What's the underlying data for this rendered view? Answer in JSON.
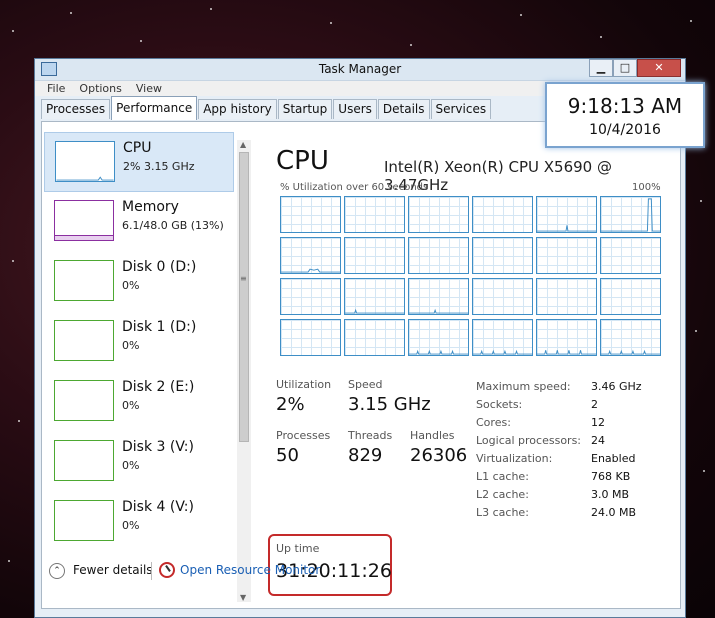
{
  "window": {
    "title": "Task Manager",
    "minimize": "▁",
    "maximize": "□",
    "close": "✕"
  },
  "menu": [
    "File",
    "Options",
    "View"
  ],
  "tabs": [
    "Processes",
    "Performance",
    "App history",
    "Startup",
    "Users",
    "Details",
    "Services"
  ],
  "active_tab": "Performance",
  "sidebar": [
    {
      "name": "CPU",
      "value": "2% 3.15 GHz",
      "kind": "cpu"
    },
    {
      "name": "Memory",
      "value": "6.1/48.0 GB (13%)",
      "kind": "mem"
    },
    {
      "name": "Disk 0 (D:)",
      "value": "0%",
      "kind": "disk"
    },
    {
      "name": "Disk 1 (D:)",
      "value": "0%",
      "kind": "disk"
    },
    {
      "name": "Disk 2 (E:)",
      "value": "0%",
      "kind": "disk"
    },
    {
      "name": "Disk 3 (V:)",
      "value": "0%",
      "kind": "disk"
    },
    {
      "name": "Disk 4 (V:)",
      "value": "0%",
      "kind": "disk"
    }
  ],
  "main": {
    "title": "CPU",
    "processor": "Intel(R) Xeon(R) CPU X5690 @ 3.47GHz",
    "graph_label": "% Utilization over 60 seconds",
    "graph_max": "100%"
  },
  "stats": {
    "utilization_label": "Utilization",
    "utilization": "2%",
    "speed_label": "Speed",
    "speed": "3.15 GHz",
    "processes_label": "Processes",
    "processes": "50",
    "threads_label": "Threads",
    "threads": "829",
    "handles_label": "Handles",
    "handles": "26306",
    "uptime_label": "Up time",
    "uptime": "31:20:11:26"
  },
  "specs": [
    {
      "key": "Maximum speed:",
      "value": "3.46 GHz"
    },
    {
      "key": "Sockets:",
      "value": "2"
    },
    {
      "key": "Cores:",
      "value": "12"
    },
    {
      "key": "Logical processors:",
      "value": "24"
    },
    {
      "key": "Virtualization:",
      "value": "Enabled"
    },
    {
      "key": "L1 cache:",
      "value": "768 KB"
    },
    {
      "key": "L2 cache:",
      "value": "3.0 MB"
    },
    {
      "key": "L3 cache:",
      "value": "24.0 MB"
    }
  ],
  "footer": {
    "fewer_details": "Fewer details",
    "resource_monitor": "Open Resource Monitor"
  },
  "clock": {
    "time": "9:18:13 AM",
    "date": "10/4/2016"
  },
  "colors": {
    "cpu": "#3e8ec6",
    "memory": "#8b2fa0",
    "disk": "#4da832",
    "highlight": "#c42a2a",
    "link": "#1a5fb4"
  }
}
